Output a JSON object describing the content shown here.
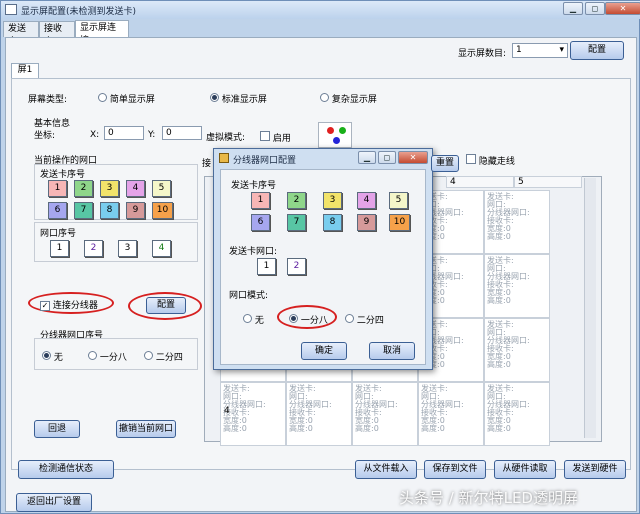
{
  "window": {
    "title": "显示屏配置(未检测到发送卡)",
    "controls": [
      "▁",
      "◻",
      "✕"
    ]
  },
  "tabs": [
    {
      "label": "发送卡"
    },
    {
      "label": "接收卡"
    },
    {
      "label": "显示屏连接"
    }
  ],
  "screen_count": {
    "label": "显示屏数目:",
    "value": "1",
    "config_button": "配置"
  },
  "screen_tab": {
    "label": "屏1"
  },
  "screen_type": {
    "label": "屏幕类型:",
    "options": [
      {
        "label": "简单显示屏",
        "selected": false
      },
      {
        "label": "标准显示屏",
        "selected": true
      },
      {
        "label": "复杂显示屏",
        "selected": false
      }
    ]
  },
  "basic_info": {
    "label": "基本信息",
    "coord_label": "坐标:",
    "x_label": "X:",
    "x_value": "0",
    "y_label": "Y:",
    "y_value": "0",
    "virtual_mode_label": "虚拟模式:",
    "enable_label": "启用"
  },
  "current_port": {
    "label": "当前操作的网口",
    "send_card_label": "发送卡序号",
    "send_cards": [
      "1",
      "2",
      "3",
      "4",
      "5",
      "6",
      "7",
      "8",
      "9",
      "10"
    ],
    "port_label": "网口序号",
    "ports": [
      "1",
      "2",
      "3",
      "4"
    ]
  },
  "splitter": {
    "checkbox_label": "连接分线器",
    "config_button": "配置",
    "port_label": "分线器网口序号",
    "options": [
      {
        "label": "无",
        "selected": true
      },
      {
        "label": "一分八",
        "selected": false
      },
      {
        "label": "二分四",
        "selected": false
      }
    ]
  },
  "buttons": {
    "back": "回退",
    "undo_port": "撤销当前网口",
    "detect": "检测通信状态",
    "load_file": "从文件载入",
    "save_file": "保存到文件",
    "read_hw": "从硬件读取",
    "send_hw": "发送到硬件",
    "factory": "返回出厂设置"
  },
  "grid": {
    "hide_lines_label": "隐藏走线",
    "partial_button_label": "重置",
    "partial_left_label": "接",
    "columns": [
      "4",
      "5"
    ],
    "row_label": "4",
    "cell_text": [
      "发送卡:",
      "网口:",
      "分线器网口:",
      "接收卡:",
      "宽度:0",
      "高度:0"
    ]
  },
  "dialog": {
    "title": "分线器网口配置",
    "send_card_label": "发送卡序号",
    "send_cards": [
      "1",
      "2",
      "3",
      "4",
      "5",
      "6",
      "7",
      "8",
      "9",
      "10"
    ],
    "port_label": "发送卡网口:",
    "ports": [
      "1",
      "2"
    ],
    "mode_label": "网口模式:",
    "modes": [
      {
        "label": "无",
        "selected": false
      },
      {
        "label": "一分八",
        "selected": true
      },
      {
        "label": "二分四",
        "selected": false
      }
    ],
    "ok": "确定",
    "cancel": "取消"
  },
  "watermark": "头条号 / 新尔特LED透明屏",
  "colors": {
    "card_1": "#f7b6b6",
    "card_2": "#8fd68a",
    "card_3": "#f2e36a",
    "card_4": "#e4a3e8",
    "card_5": "#f4f6c9",
    "card_6": "#a6a7ef",
    "card_7": "#58c6a4",
    "card_8": "#79cdee",
    "card_9": "#d69a9a",
    "card_10": "#f6a14a",
    "highlight_red": "#d62020"
  }
}
